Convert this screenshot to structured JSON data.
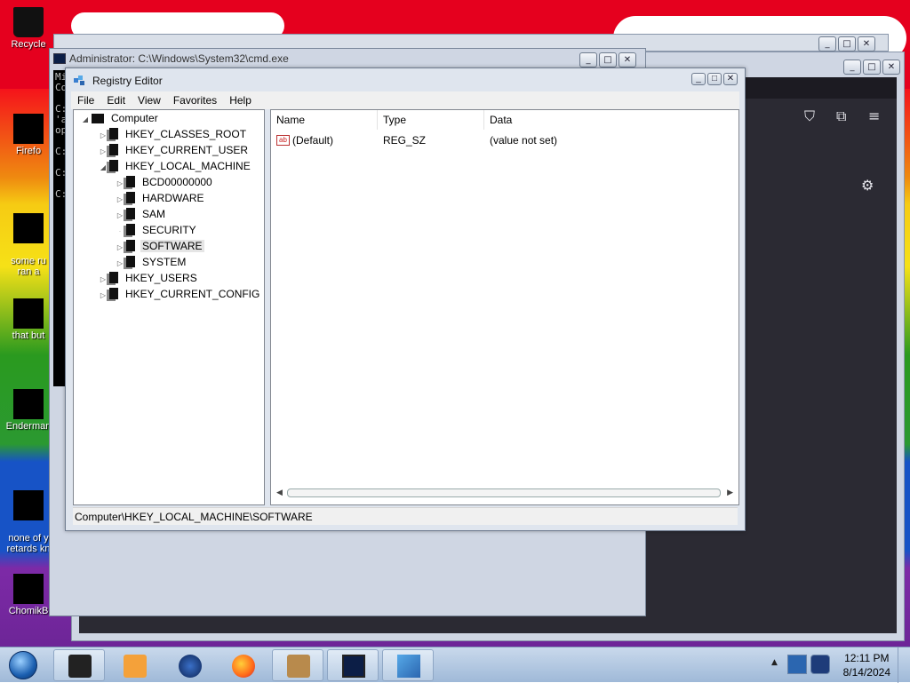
{
  "desktop": {
    "icons": [
      {
        "label": "Recycle"
      },
      {
        "label": "Firefo"
      },
      {
        "label": "some ru\nran a"
      },
      {
        "label": "that but"
      },
      {
        "label": "Enderman"
      },
      {
        "label": "none of y\nretards kn"
      },
      {
        "label": "ChomikB"
      }
    ]
  },
  "cmd": {
    "title": "Administrator: C:\\Windows\\System32\\cmd.exe",
    "console_lines": [
      "Mi",
      "Co",
      "",
      "C:",
      "'a",
      "op",
      "",
      "C:",
      "",
      "C:",
      "",
      "C:"
    ]
  },
  "regedit": {
    "title": "Registry Editor",
    "menu": [
      "File",
      "Edit",
      "View",
      "Favorites",
      "Help"
    ],
    "tree": {
      "root": "Computer",
      "hives": [
        "HKEY_CLASSES_ROOT",
        "HKEY_CURRENT_USER",
        "HKEY_LOCAL_MACHINE",
        "HKEY_USERS",
        "HKEY_CURRENT_CONFIG"
      ],
      "hklm_children": [
        "BCD00000000",
        "HARDWARE",
        "SAM",
        "SECURITY",
        "SOFTWARE",
        "SYSTEM"
      ],
      "selected": "SOFTWARE"
    },
    "columns": [
      "Name",
      "Type",
      "Data"
    ],
    "values": [
      {
        "name": "(Default)",
        "type": "REG_SZ",
        "data": "(value not set)"
      }
    ],
    "status": "Computer\\HKEY_LOCAL_MACHINE\\SOFTWARE"
  },
  "taskbar": {
    "time": "12:11 PM",
    "date": "8/14/2024"
  },
  "colors": {
    "taskbar_bg": "#b5cbe4",
    "console_bg": "#000000",
    "browser_dark": "#2b2a33"
  }
}
